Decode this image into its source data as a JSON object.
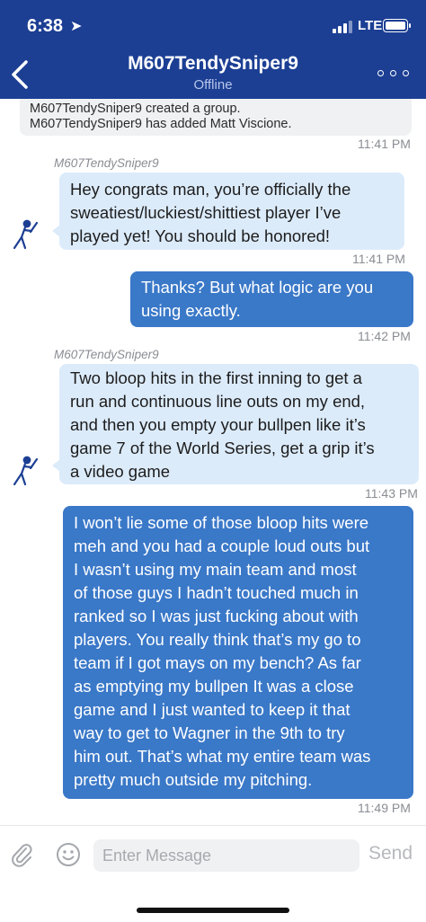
{
  "status_bar": {
    "time": "6:38",
    "location_glyph": "➤",
    "carrier": "LTE"
  },
  "header": {
    "back_icon": "chevron-left-icon",
    "title": "M607TendySniper9",
    "subtitle": "Offline",
    "more_icon": "ellipsis-icon"
  },
  "system_note": {
    "line1": "M607TendySniper9 created a group.",
    "line2": "M607TendySniper9 has added Matt Viscione.",
    "time": "11:41 PM"
  },
  "messages": [
    {
      "direction": "incoming",
      "sender": "M607TendySniper9",
      "lines": [
        "Hey congrats man, you’re officially the",
        "sweatiest/luckiest/shittiest player I’ve",
        "played yet! You should be honored!"
      ],
      "time": "11:41 PM"
    },
    {
      "direction": "outgoing",
      "lines": [
        "Thanks? But what logic are you",
        "using exactly."
      ],
      "time": "11:42 PM"
    },
    {
      "direction": "incoming",
      "sender": "M607TendySniper9",
      "lines": [
        "Two bloop hits in the first inning to get a",
        "run and continuous line outs on my end,",
        "and then you empty your bullpen like it’s",
        "game 7 of the World Series, get a grip it’s",
        "a video game"
      ],
      "time": "11:43 PM"
    },
    {
      "direction": "outgoing",
      "lines": [
        "I won’t lie some of those bloop hits were",
        "meh and you had a couple loud outs but",
        "I wasn’t using my main team and most",
        "of those guys I hadn’t touched much in",
        "ranked so I was just fucking about with",
        "players. You really think that’s my go to",
        "team  if I got mays on my bench?  As far",
        "as emptying my bullpen It was a close",
        "game and I just wanted to keep it that",
        "way to get to Wagner in the 9th to try",
        "him out. That’s what my entire team was",
        "pretty much outside my pitching."
      ],
      "time": "11:49 PM"
    }
  ],
  "composer": {
    "placeholder": "Enter Message",
    "send_label": "Send",
    "attach_icon": "paperclip-icon",
    "emoji_icon": "smiley-icon"
  },
  "colors": {
    "header": "#1c3f94",
    "incoming_bubble": "#dcebfa",
    "outgoing_bubble": "#3a78c8",
    "timestamp": "#8a8d93"
  }
}
